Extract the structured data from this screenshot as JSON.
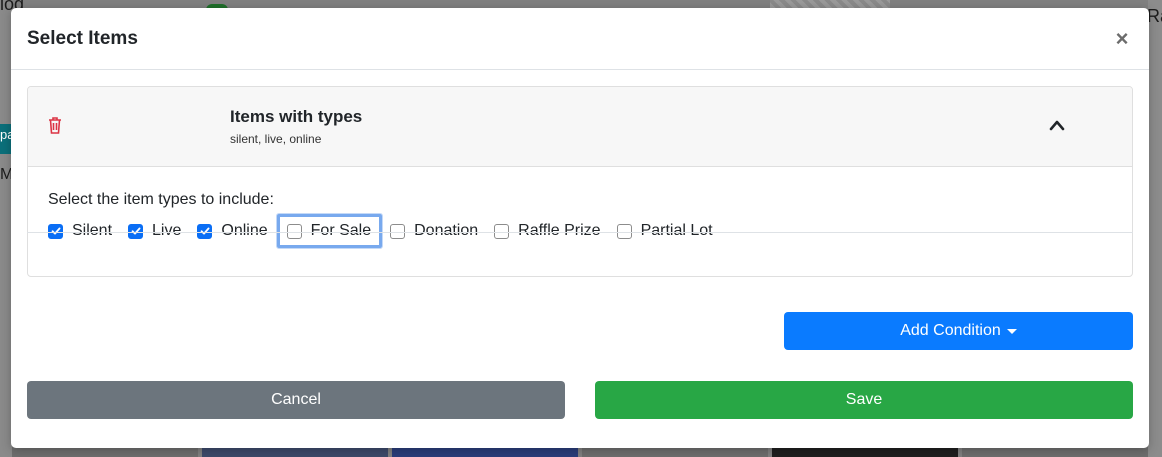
{
  "background": {
    "left_fragments": [
      "log",
      "pa",
      "M"
    ],
    "right_fragment": "Ra"
  },
  "modal": {
    "title": "Select Items",
    "close_symbol": "×",
    "condition_card": {
      "title": "Items with types",
      "subtitle": "silent, live, online",
      "delete_icon": "trash-icon",
      "collapse_icon": "chevron-up-icon",
      "prompt": "Select the item types to include:",
      "types": [
        {
          "label": "Silent",
          "checked": true
        },
        {
          "label": "Live",
          "checked": true
        },
        {
          "label": "Online",
          "checked": true
        },
        {
          "label": "For Sale",
          "checked": false,
          "focused": true
        },
        {
          "label": "Donation",
          "checked": false
        },
        {
          "label": "Raffle Prize",
          "checked": false
        },
        {
          "label": "Partial Lot",
          "checked": false
        }
      ]
    },
    "add_condition_label": "Add Condition",
    "cancel_label": "Cancel",
    "save_label": "Save"
  },
  "colors": {
    "primary": "#0a7bff",
    "checkbox_checked": "#0a6ef5",
    "cancel": "#6c757d",
    "save": "#28a745",
    "delete_icon": "#dc3545",
    "focus_ring": "#78a9ee"
  }
}
